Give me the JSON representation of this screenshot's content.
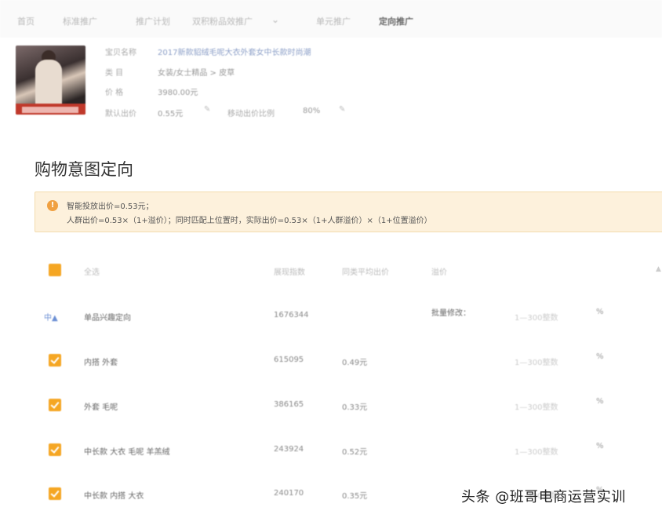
{
  "nav": {
    "items": [
      "首页",
      "标准推广",
      "推广计划",
      "双积粉品效推广",
      "单元推广",
      "定向推广"
    ],
    "dropdown_icon": "chevron-down-icon"
  },
  "product": {
    "labels": {
      "name": "宝贝名称",
      "category": "类   目",
      "price": "价   格",
      "default_bid": "默认出价",
      "mobile_ratio": "移动出价比例"
    },
    "name": "2017新款貂绒毛呢大衣外套女中长款时尚潮",
    "category": "女装/女士精品 > 皮草",
    "price": "3980.00元",
    "default_bid": "0.55元",
    "mobile_ratio": "80%",
    "edit_icon": "pencil-icon"
  },
  "section_title": "购物意图定向",
  "notice": {
    "icon": "warning-icon",
    "line1": "智能投放出价=0.53元；",
    "line2": "人群出价=0.53×（1+溢价）；同时匹配上位置时，实际出价=0.53×（1+人群溢价）×（1+位置溢价）"
  },
  "table": {
    "headers": {
      "select_all": "全选",
      "index": "展现指数",
      "avg_bid": "同类平均出价",
      "premium": "溢价"
    },
    "group": {
      "toggle": "中▲",
      "label": "单品兴趣定向",
      "index": "1676344",
      "batch_label": "批量修改：",
      "batch_placeholder": "1—300整数",
      "unit": "%"
    },
    "rows": [
      {
        "label": "内搭 外套",
        "index": "615095",
        "bid": "0.49元",
        "placeholder": "1—300整数",
        "unit": "%"
      },
      {
        "label": "外套 毛呢",
        "index": "386165",
        "bid": "0.33元",
        "placeholder": "1—300整数",
        "unit": "%"
      },
      {
        "label": "中长款 大衣 毛呢 羊羔绒",
        "index": "243924",
        "bid": "0.52元",
        "placeholder": "1—300整数",
        "unit": "%"
      },
      {
        "label": "中长款 内搭 大衣",
        "index": "240170",
        "bid": "0.35元",
        "placeholder": "1—300整数",
        "unit": "%"
      }
    ]
  },
  "watermark": "头条 @班哥电商运营实训",
  "colors": {
    "accent": "#f5a623",
    "notice_bg": "#fdf1dc",
    "link": "#6b8fd4"
  }
}
